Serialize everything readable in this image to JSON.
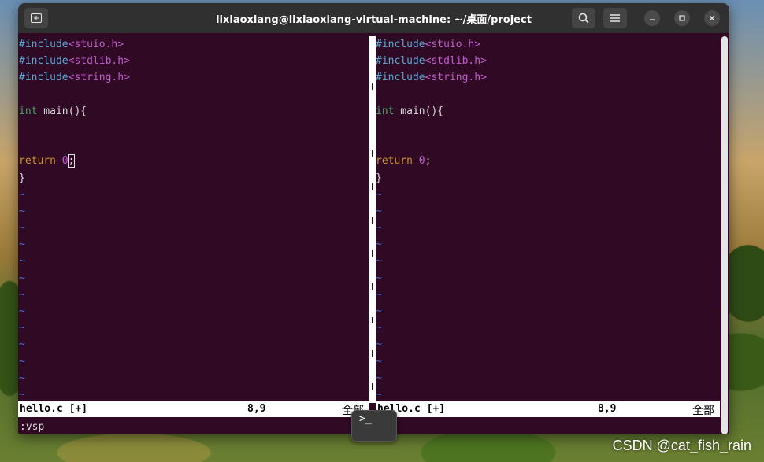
{
  "window": {
    "title": "lixiaoxiang@lixiaoxiang-virtual-machine: ~/桌面/project",
    "new_tab_icon": "new-tab-icon",
    "search_icon": "search-icon",
    "menu_icon": "hamburger-menu-icon",
    "minimize_icon": "minimize-icon",
    "maximize_icon": "maximize-icon",
    "close_icon": "close-icon"
  },
  "editor": {
    "left_pane": {
      "lines": {
        "l1_pp": "#include",
        "l1_hdr": "<stuio.h>",
        "l2_pp": "#include",
        "l2_hdr": "<stdlib.h>",
        "l3_pp": "#include",
        "l3_hdr": "<string.h>",
        "l5_type": "int",
        "l5_rest": " main(){",
        "l8_kw": "return",
        "l8_sp": " ",
        "l8_num": "0",
        "l8_semi": ";",
        "l9": "}"
      },
      "tilde": "~"
    },
    "right_pane": {
      "lines": {
        "l1_pp": "#include",
        "l1_hdr": "<stuio.h>",
        "l2_pp": "#include",
        "l2_hdr": "<stdlib.h>",
        "l3_pp": "#include",
        "l3_hdr": "<string.h>",
        "l5_type": "int",
        "l5_rest": " main(){",
        "l8_kw": "return",
        "l8_sp": " ",
        "l8_num": "0",
        "l8_semi": ";",
        "l9": "}"
      },
      "tilde": "~"
    },
    "status_left": {
      "file": "hello.c [+]",
      "position": "8,9",
      "scroll": "全部"
    },
    "status_right": {
      "file": "hello.c [+]",
      "position": "8,9",
      "scroll": "全部"
    },
    "command_line": ":vsp"
  },
  "dock": {
    "terminal_label": ">_"
  },
  "watermark": "CSDN @cat_fish_rain",
  "colors": {
    "terminal_bg": "#300a24",
    "preprocessor": "#5aa7d6",
    "header": "#c25ad0",
    "type": "#47a869",
    "keyword": "#c8902e",
    "tilde": "#4a6ecc"
  }
}
